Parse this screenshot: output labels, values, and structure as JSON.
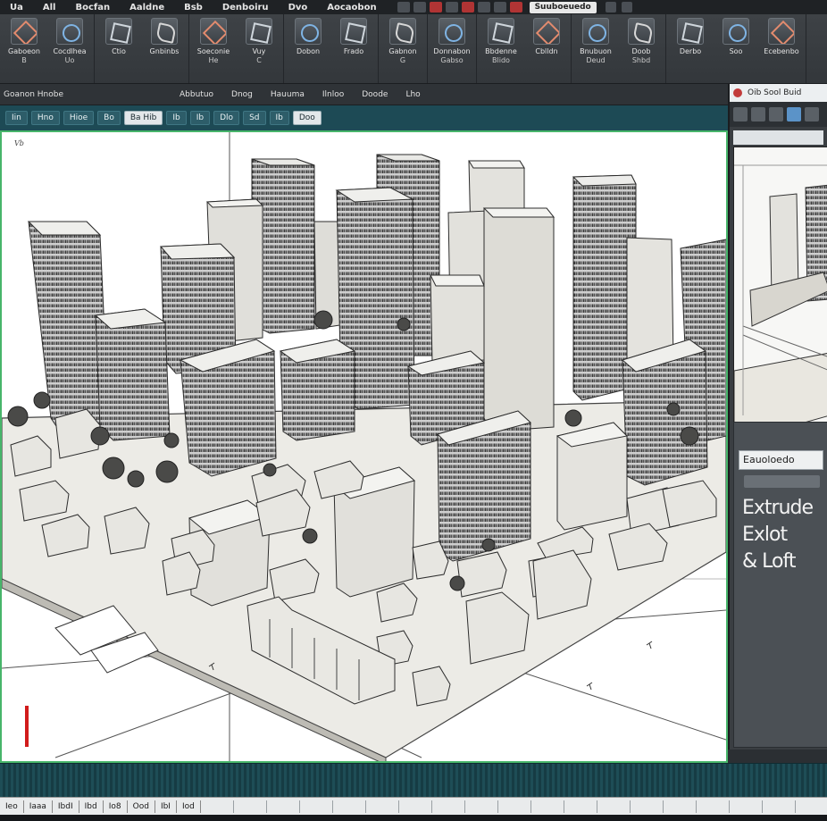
{
  "menubar": {
    "items": [
      "Ua",
      "All",
      "Bocfan",
      "Aaldne",
      "Bsb",
      "Denboiru",
      "Dvo",
      "Aocaobon"
    ],
    "brand": "Suuboeuedo"
  },
  "ribbon": {
    "groups": [
      {
        "tools": [
          {
            "label": "Gaboeon",
            "sub": "B"
          },
          {
            "label": "Cocdlhea",
            "sub": "Uo"
          }
        ]
      },
      {
        "tools": [
          {
            "label": "Ctio",
            "sub": ""
          },
          {
            "label": "Gnbinbs",
            "sub": ""
          }
        ]
      },
      {
        "tools": [
          {
            "label": "Soeconie",
            "sub": "He"
          },
          {
            "label": "Vuy",
            "sub": "C"
          }
        ]
      },
      {
        "tools": [
          {
            "label": "Dobon",
            "sub": ""
          },
          {
            "label": "Frado",
            "sub": ""
          }
        ]
      },
      {
        "tools": [
          {
            "label": "Gabnon",
            "sub": "G"
          }
        ]
      },
      {
        "tools": [
          {
            "label": "Donnabon",
            "sub": "Gabso"
          }
        ]
      },
      {
        "tools": [
          {
            "label": "Bbdenne",
            "sub": "Blido"
          },
          {
            "label": "Cblldn",
            "sub": ""
          }
        ]
      },
      {
        "tools": [
          {
            "label": "Bnubuon",
            "sub": "Deud"
          },
          {
            "label": "Doob",
            "sub": "Shbd"
          }
        ]
      },
      {
        "tools": [
          {
            "label": "Derbo",
            "sub": ""
          },
          {
            "label": "Soo",
            "sub": ""
          },
          {
            "label": "Ecebenbo",
            "sub": ""
          }
        ]
      }
    ]
  },
  "options": {
    "left": "Goanon Hnobe",
    "items": [
      "Abbutuo",
      "Dnog",
      "Hauuma",
      "Ilnloo",
      "Doode",
      "Lho"
    ]
  },
  "viewport_toolbar": {
    "buttons": [
      "Iin",
      "Hno",
      "Hioe",
      "Bo",
      "Ba Hib",
      "Ib",
      "Ib",
      "Dlo",
      "Sd",
      "Ib",
      "Doo"
    ],
    "selected_index": 4
  },
  "viewport": {
    "label": "Vb"
  },
  "right_panel": {
    "header": "Oib Sool Buid",
    "properties_title": "Eauoloedo",
    "commands": [
      "Extrude",
      "Exlot",
      "& Loft"
    ]
  },
  "statusbar": {
    "items": [
      "Ieo",
      "Iaaa",
      "IbdI",
      "Ibd",
      "Io8",
      "Ood",
      "IbI",
      "Iod"
    ]
  }
}
